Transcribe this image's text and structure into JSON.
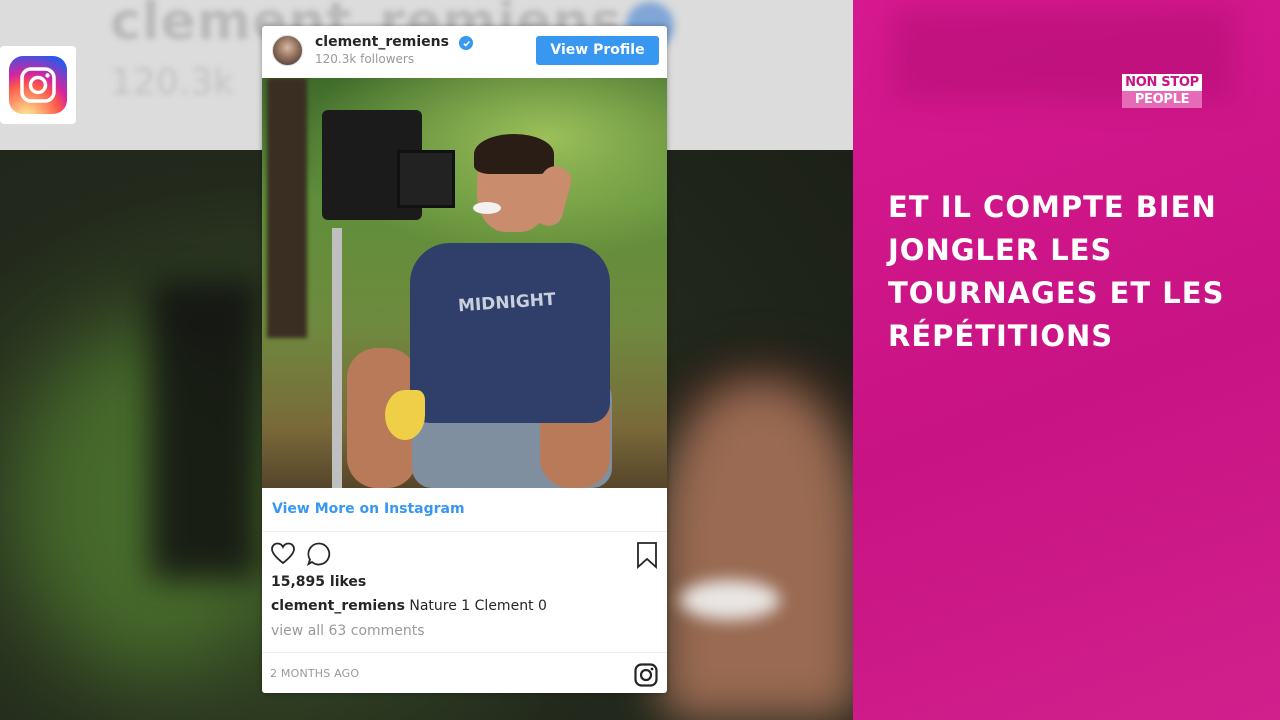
{
  "backdrop": {
    "ghost_name": "clement_remiens",
    "ghost_sub": "120.3k"
  },
  "post": {
    "username": "clement_remiens",
    "followers": "120.3k followers",
    "view_profile_label": "View Profile",
    "photo_shirt_text": "MIDNIGHT",
    "view_more_label": "View More on Instagram",
    "likes": "15,895 likes",
    "caption_user": "clement_remiens",
    "caption_text": "Nature 1 Clement 0",
    "comments_link": "view all 63 comments",
    "timestamp": "2 MONTHS AGO"
  },
  "panel": {
    "brand_line1": "NON STOP",
    "brand_line2": "PEOPLE",
    "headline": "ET IL COMPTE BIEN JONGLER LES TOURNAGES ET LES RÉPÉTITIONS"
  },
  "colors": {
    "accent_blue": "#3897f0",
    "panel_pink": "#c81384"
  },
  "icons": [
    "instagram-app-icon",
    "verified-icon",
    "heart-icon",
    "comment-icon",
    "bookmark-icon",
    "instagram-glyph-icon"
  ]
}
